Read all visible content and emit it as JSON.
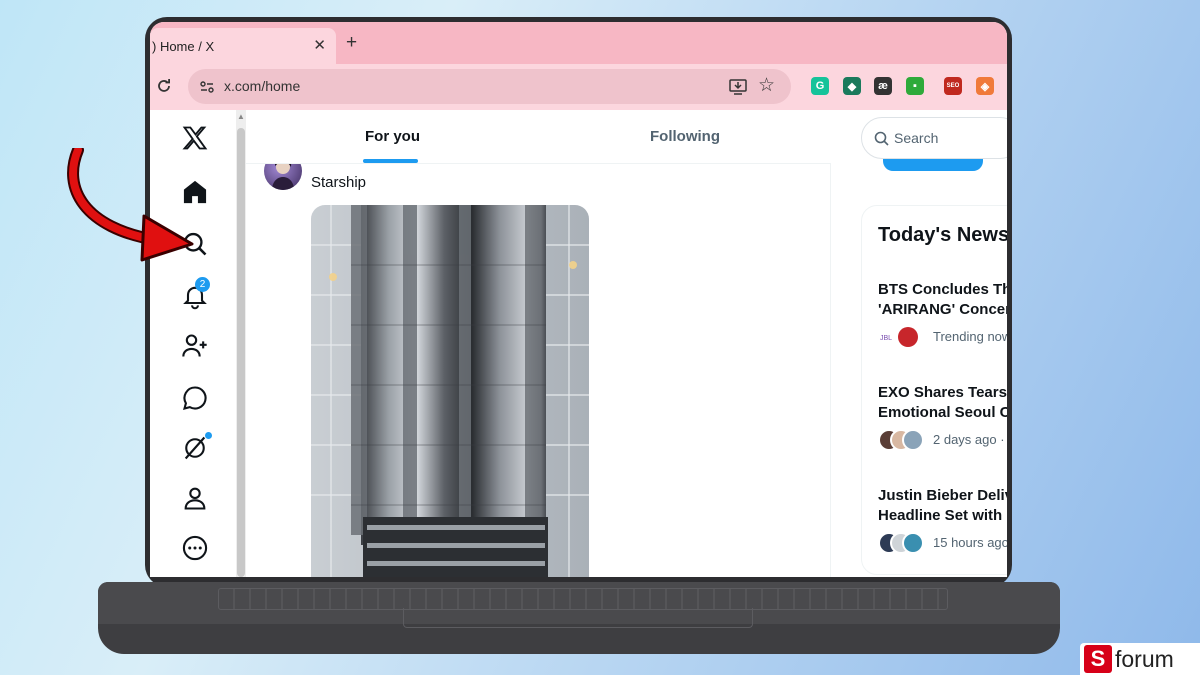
{
  "browser": {
    "tab_title": ") Home / X",
    "tab_close": "✕",
    "new_tab": "+",
    "reload": "C",
    "url": "x.com/home",
    "star": "☆",
    "extensions": [
      {
        "name": "grammarly-icon",
        "label": "G",
        "color": "#15c39a"
      },
      {
        "name": "extension-green-icon",
        "label": "◆",
        "color": "#1a7a5c"
      },
      {
        "name": "ae-icon",
        "label": "æ",
        "color": "#333333"
      },
      {
        "name": "extension-gift-icon",
        "label": "▪",
        "color": "#2eaa3a"
      },
      {
        "name": "seo-icon",
        "label": "SEO",
        "color": "#c0291f"
      },
      {
        "name": "extension-orange-icon",
        "label": "◈",
        "color": "#f07a3a"
      }
    ]
  },
  "nav": {
    "notifications_badge": "2"
  },
  "feed": {
    "tabs": {
      "for_you": "For you",
      "following": "Following"
    },
    "post": {
      "text": "Starship"
    }
  },
  "sidebar": {
    "search_placeholder": "Search",
    "news_title": "Today's News",
    "stories": [
      {
        "line1": "BTS Concludes Th",
        "line2": "'ARIRANG' Concert",
        "meta": "Trending now"
      },
      {
        "line1": "EXO Shares Tears a",
        "line2": "Emotional Seoul C",
        "meta": "2 days ago · E"
      },
      {
        "line1": "Justin Bieber Deliv",
        "line2": "Headline Set with",
        "meta": "15 hours ago"
      }
    ]
  },
  "watermark": {
    "s": "S",
    "text": "forum"
  },
  "colors": {
    "accent": "#1d9bf0",
    "tab_strip": "#f7b7c4",
    "arrow": "#e01010"
  }
}
